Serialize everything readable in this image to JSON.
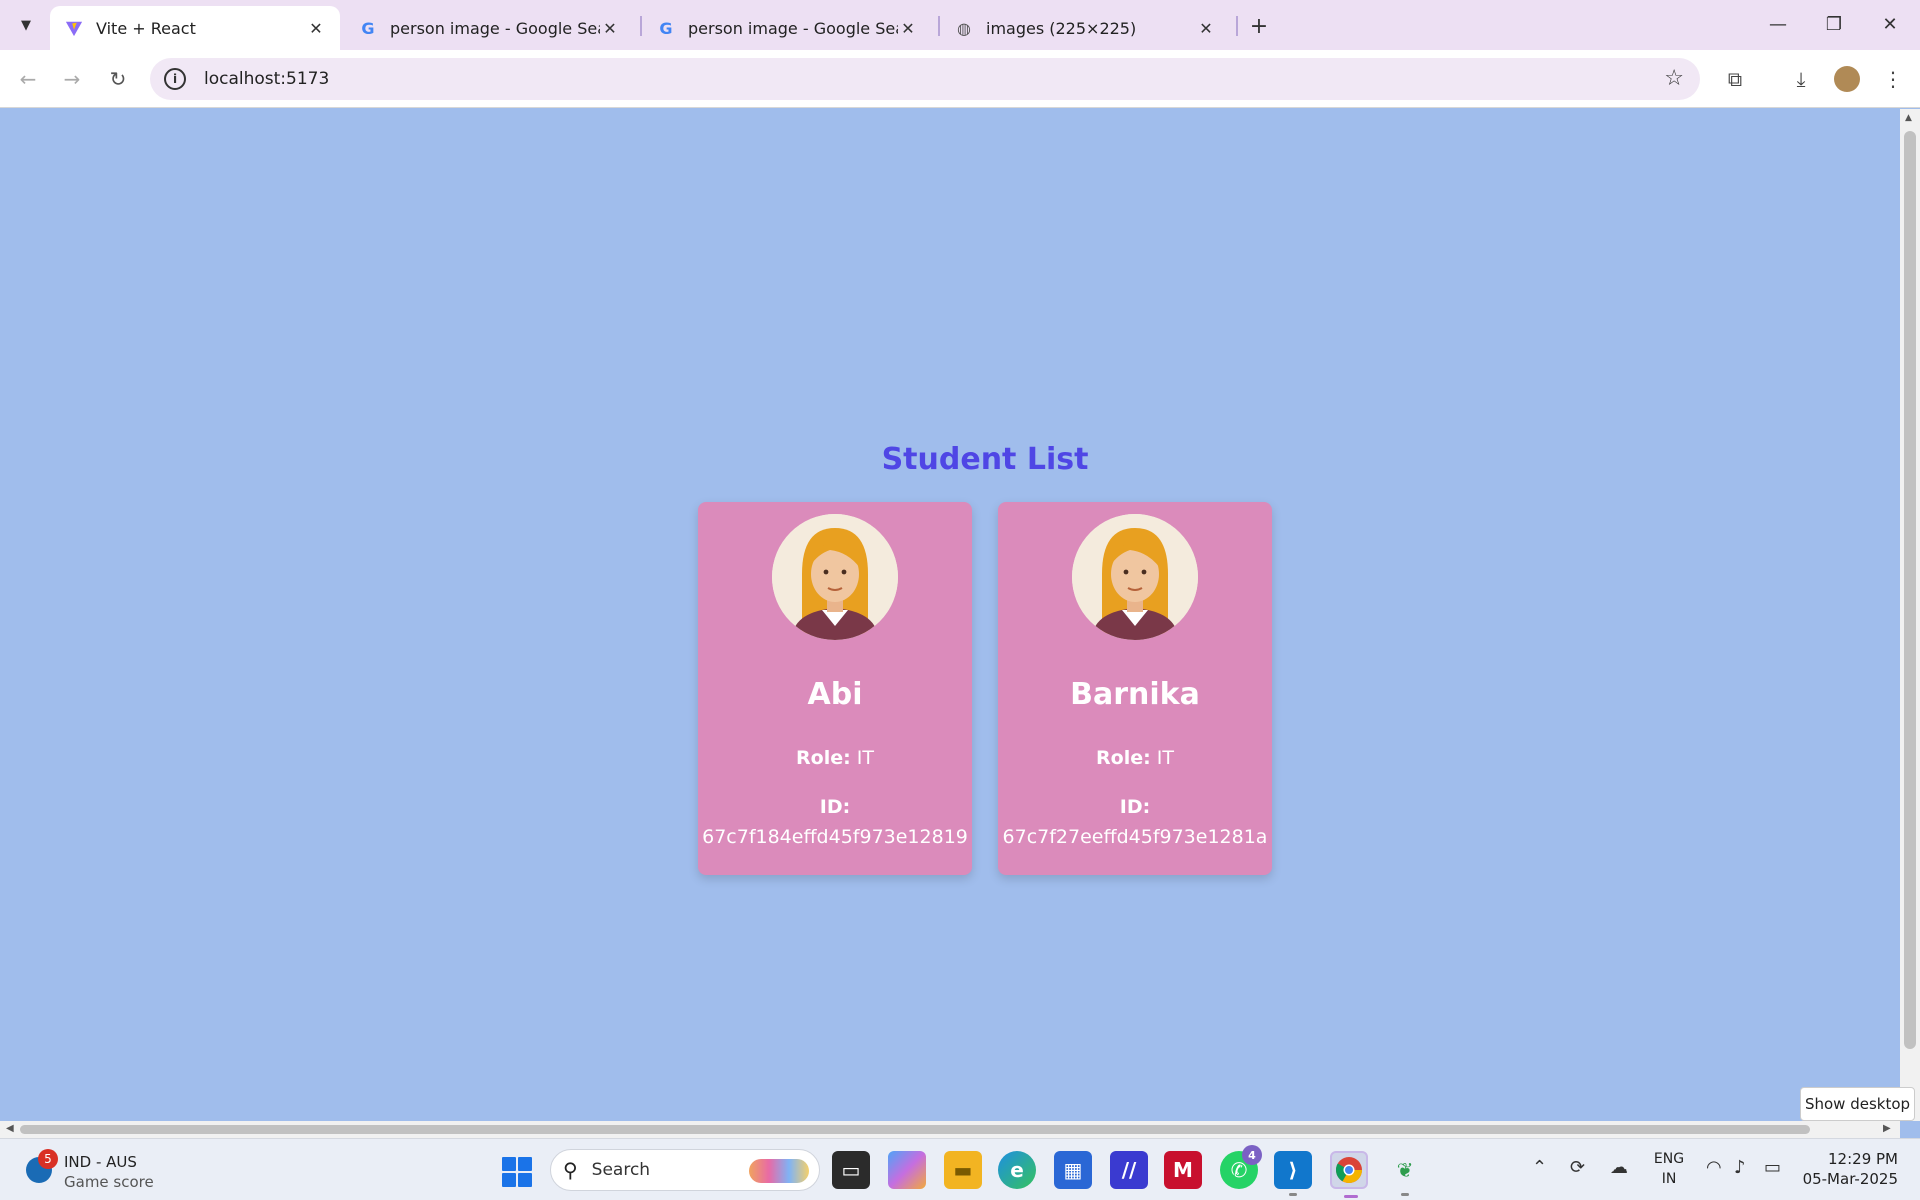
{
  "browser": {
    "tabs": [
      {
        "title": "Vite + React",
        "favicon": "vite-icon",
        "active": true
      },
      {
        "title": "person image - Google Search",
        "favicon": "google-icon",
        "active": false
      },
      {
        "title": "person image - Google Search",
        "favicon": "google-icon",
        "active": false
      },
      {
        "title": "images (225×225)",
        "favicon": "globe-icon",
        "active": false
      }
    ],
    "url": "localhost:5173"
  },
  "page": {
    "title": "Student List",
    "title_color": "#4f46e5",
    "background": "#a0bdec",
    "card_color": "#db8bbb",
    "students": [
      {
        "name": "Abi",
        "role_label": "Role:",
        "role": "IT",
        "id_label": "ID:",
        "id": "67c7f184effd45f973e12819",
        "avatar": "woman-avatar-icon"
      },
      {
        "name": "Barnika",
        "role_label": "Role:",
        "role": "IT",
        "id_label": "ID:",
        "id": "67c7f27eeffd45f973e1281a",
        "avatar": "woman-avatar-icon"
      }
    ]
  },
  "tooltip": "Show desktop",
  "taskbar": {
    "widget_badge": "5",
    "widget_title": "IND - AUS",
    "widget_subtitle": "Game score",
    "search_label": "Search",
    "whatsapp_badge": "4",
    "lang_line1": "ENG",
    "lang_line2": "IN",
    "time": "12:29 PM",
    "date": "05-Mar-2025"
  }
}
